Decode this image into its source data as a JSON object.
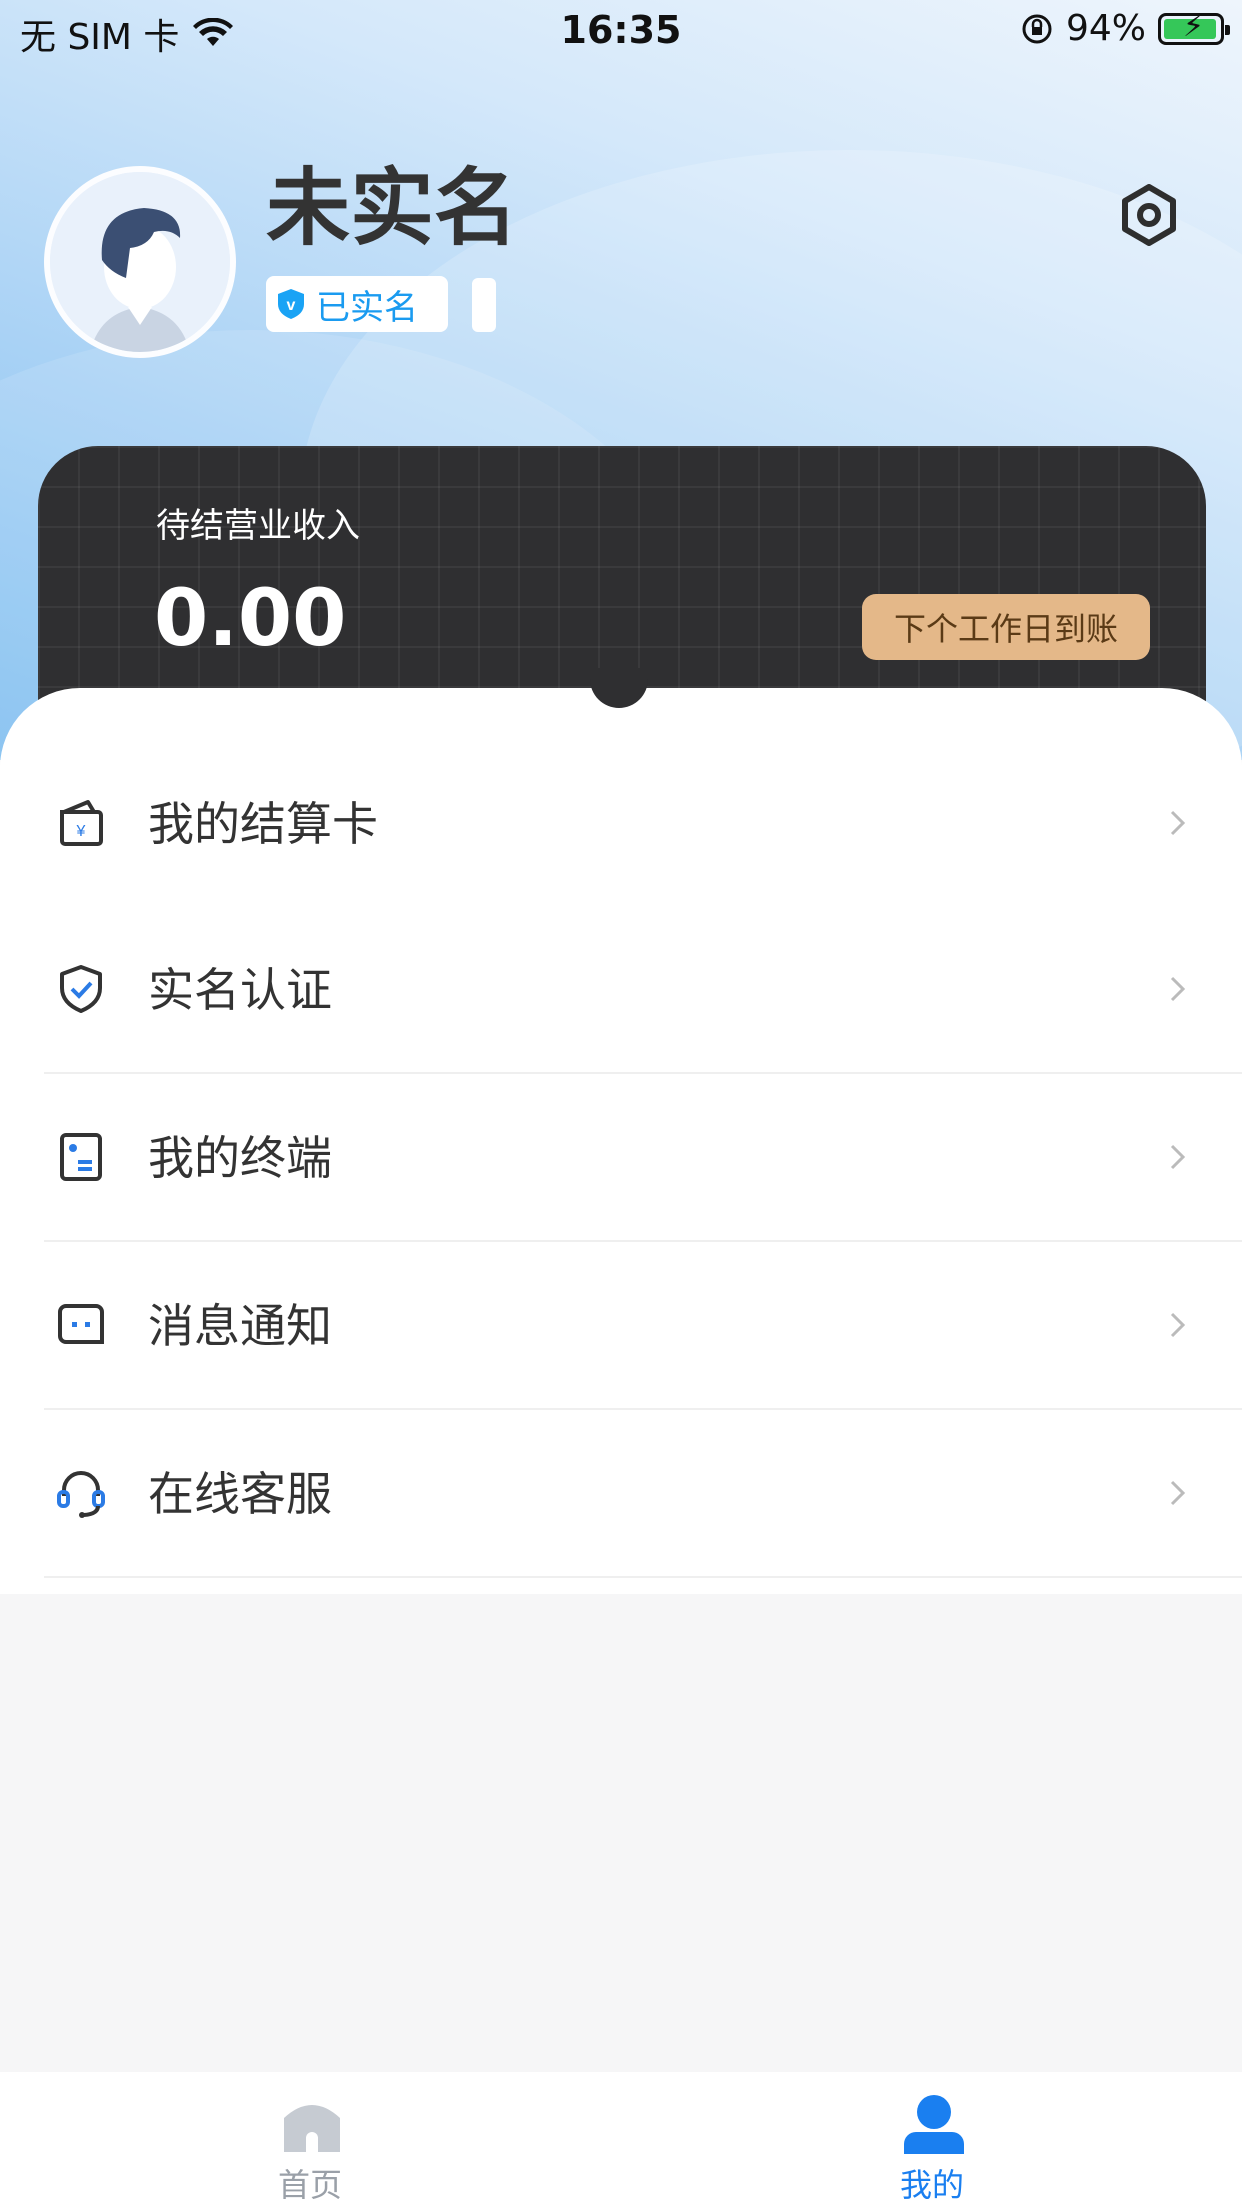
{
  "status_bar": {
    "carrier": "无 SIM 卡",
    "time": "16:35",
    "battery": "94%"
  },
  "profile": {
    "name": "未实名",
    "verified_label": "已实名"
  },
  "income": {
    "label": "待结营业收入",
    "value": "0.00",
    "payout_note": "下个工作日到账"
  },
  "menu": [
    {
      "label": "我的结算卡",
      "icon": "wallet-icon"
    },
    {
      "label": "实名认证",
      "icon": "shield-check-icon"
    },
    {
      "label": "我的终端",
      "icon": "terminal-icon"
    },
    {
      "label": "消息通知",
      "icon": "message-icon"
    },
    {
      "label": "在线客服",
      "icon": "headset-icon"
    }
  ],
  "tabbar": {
    "home": "首页",
    "mine": "我的"
  },
  "colors": {
    "accent": "#1a7ff0",
    "card_dark": "#2f2f31",
    "payout_tag": "#e4b889",
    "inactive_tab": "#9aa0a8"
  }
}
